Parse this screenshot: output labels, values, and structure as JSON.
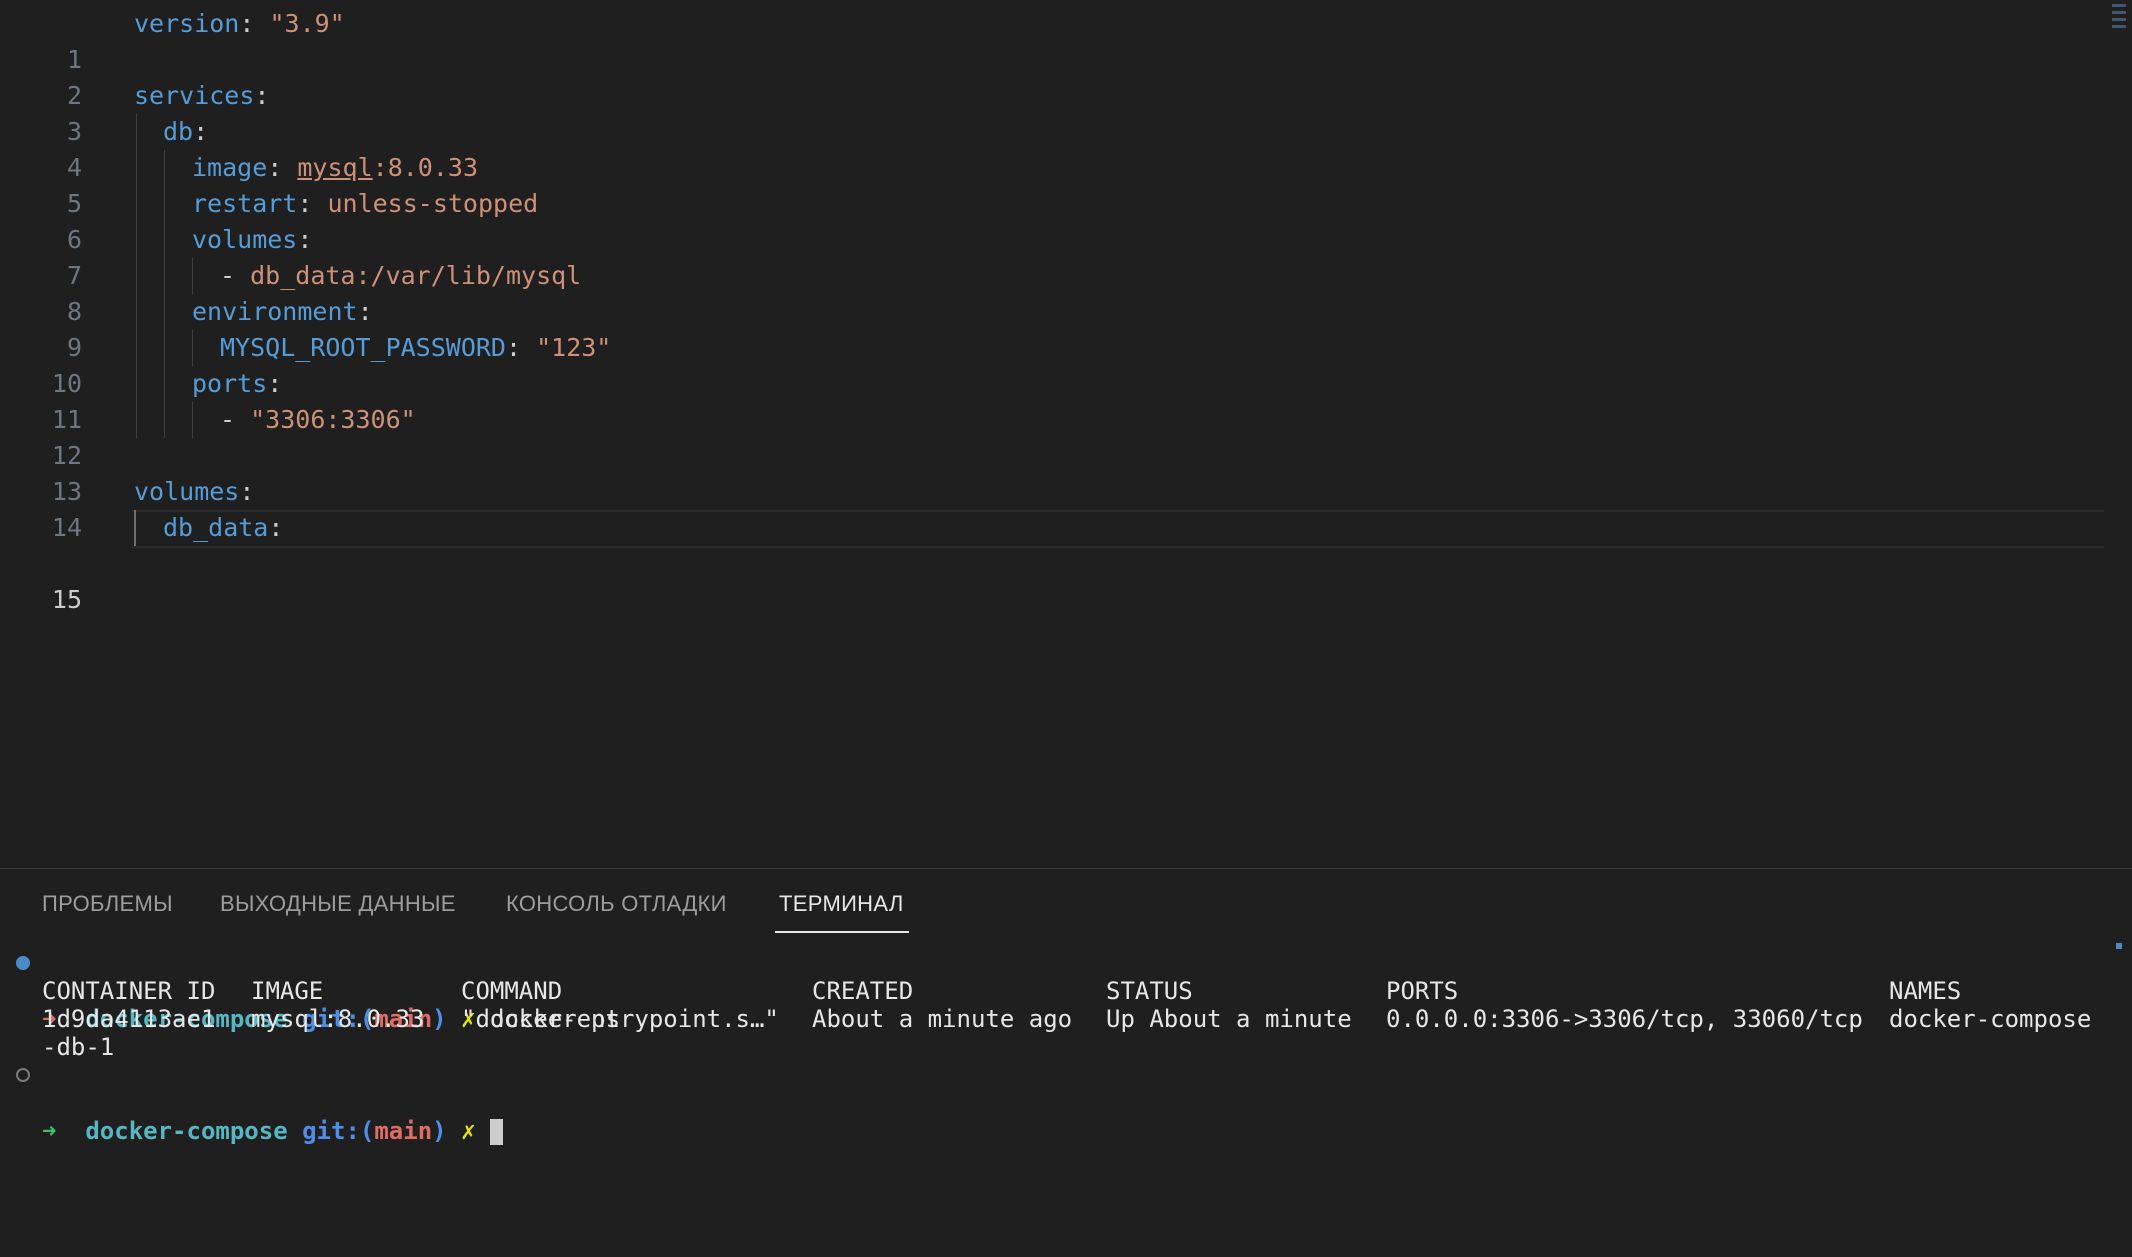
{
  "editor": {
    "lines": [
      {
        "n": "1"
      },
      {
        "n": "2"
      },
      {
        "n": "3"
      },
      {
        "n": "4"
      },
      {
        "n": "5"
      },
      {
        "n": "6"
      },
      {
        "n": "7"
      },
      {
        "n": "8"
      },
      {
        "n": "9"
      },
      {
        "n": "10"
      },
      {
        "n": "11"
      },
      {
        "n": "12"
      },
      {
        "n": "13"
      },
      {
        "n": "14"
      },
      {
        "n": "15"
      }
    ],
    "tokens": {
      "l1_key": "version",
      "l1_colon": ": ",
      "l1_val": "\"3.9\"",
      "l3_key": "services",
      "l3_colon": ":",
      "l4_key": "db",
      "l4_colon": ":",
      "l5_key": "image",
      "l5_colon": ": ",
      "l5_val_a": "mysql",
      "l5_val_b": ":8.0.33",
      "l6_key": "restart",
      "l6_colon": ": ",
      "l6_val": "unless-stopped",
      "l7_key": "volumes",
      "l7_colon": ":",
      "l8_dash": "- ",
      "l8_val": "db_data:/var/lib/mysql",
      "l9_key": "environment",
      "l9_colon": ":",
      "l10_key": "MYSQL_ROOT_PASSWORD",
      "l10_colon": ": ",
      "l10_val": "\"123\"",
      "l11_key": "ports",
      "l11_colon": ":",
      "l12_dash": "- ",
      "l12_val": "\"3306:3306\"",
      "l14_key": "volumes",
      "l14_colon": ":",
      "l15_key": "db_data",
      "l15_colon": ":"
    }
  },
  "panel": {
    "tabs": [
      {
        "label": "ПРОБЛЕМЫ"
      },
      {
        "label": "ВЫХОДНЫЕ ДАННЫЕ"
      },
      {
        "label": "КОНСОЛЬ ОТЛАДКИ"
      },
      {
        "label": "ТЕРМИНАЛ"
      }
    ],
    "terminal": {
      "prompt_arrow": "➜",
      "dir": "docker-compose",
      "git": "git:(",
      "branch": "main",
      "git_close": ")",
      "dirty": "✗",
      "command": "docker ps",
      "headers": {
        "container_id": "CONTAINER ID",
        "image": "IMAGE",
        "command": "COMMAND",
        "created": "CREATED",
        "status": "STATUS",
        "ports": "PORTS",
        "names": "NAMES"
      },
      "row": {
        "container_id": "1d9da4113ae1",
        "image": "mysql:8.0.33",
        "command": "\"docker-entrypoint.s…\"",
        "created": "About a minute ago",
        "status": "Up About a minute",
        "ports": "0.0.0.0:3306->3306/tcp, 33060/tcp",
        "names": "docker-compose",
        "names_wrap": "-db-1"
      }
    }
  },
  "colors": {
    "key": "#569cd6",
    "string": "#ce9178",
    "background": "#1f1f1f"
  }
}
